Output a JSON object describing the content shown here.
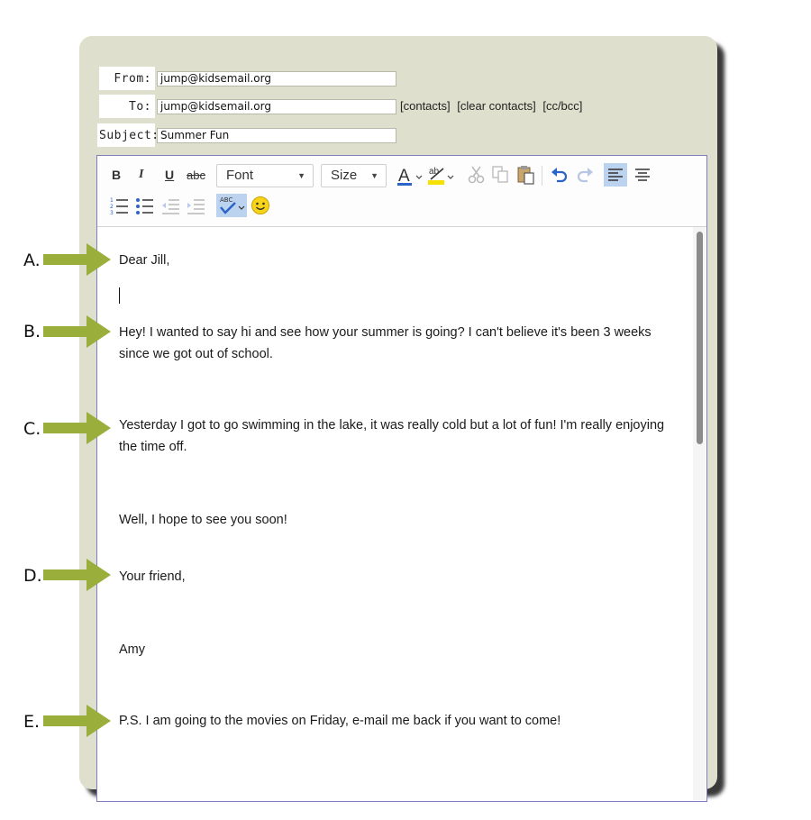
{
  "header": {
    "from_label": "From:",
    "from_value": "jump@kidsemail.org",
    "to_label": "To:",
    "to_value": "jump@kidsemail.org",
    "subject_label": "Subject:",
    "subject_value": "Summer Fun",
    "links": [
      "[contacts]",
      "[clear contacts]",
      "[cc/bcc]"
    ]
  },
  "toolbar": {
    "bold": "B",
    "italic": "I",
    "underline": "U",
    "strike": "abc",
    "font_label": "Font",
    "size_label": "Size",
    "icons": [
      "bold-icon",
      "italic-icon",
      "underline-icon",
      "strikethrough-icon",
      "font-color-icon",
      "highlight-icon",
      "cut-icon",
      "copy-icon",
      "paste-icon",
      "undo-icon",
      "redo-icon",
      "align-left-icon",
      "align-center-icon",
      "numbered-list-icon",
      "bulleted-list-icon",
      "outdent-icon",
      "indent-icon",
      "spellcheck-icon",
      "smiley-icon"
    ]
  },
  "message": {
    "greeting": "Dear Jill,",
    "para1_line1": "Hey! I wanted to say hi and see how your summer is going? I can't believe it's been 3 weeks",
    "para1_line2": "since we got out of school.",
    "para2_line1": "Yesterday I got to go swimming in the lake, it was really cold but a lot of fun! I'm really enjoying",
    "para2_line2": "the time off.",
    "closing_line": "Well, I hope to see you soon!",
    "signoff": "Your friend,",
    "name": "Amy",
    "ps": "P.S. I am going to the movies on Friday, e-mail me back if you want to come!"
  },
  "markers": [
    "A.",
    "B.",
    "C.",
    "D.",
    "E."
  ],
  "colors": {
    "panel": "#dedfcc",
    "arrow": "#9aae3c",
    "editor_border": "#7d7dc0",
    "highlight": "#f5e000",
    "font_color": "#2c63c8"
  }
}
